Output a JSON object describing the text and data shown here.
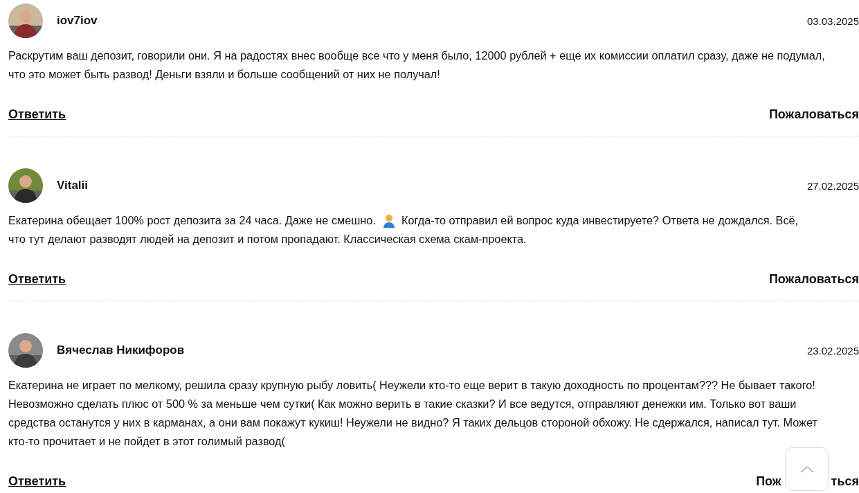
{
  "comments": [
    {
      "author": "iov7iov",
      "date": "03.03.2025",
      "text_before_icon": "Раскрутим ваш депозит, говорили они. Я на радостях внес вообще все что у меня было, 12000 рублей + еще их комиссии оплатил сразу, даже не подумал, что это может быть развод! Деньги взяли и больше сообщений от них не получал!",
      "reply": "Ответить",
      "report_parts": [
        "Пожаловаться"
      ]
    },
    {
      "author": "Vitalii",
      "date": "27.02.2025",
      "text_before_icon": "Екатерина обещает 100% рост депозита за 24 часа. Даже не смешно.",
      "text_after_icon": "Когда-то отправил ей вопрос куда инвестируете? Ответа не дождался. Всё,",
      "text_continued": "что тут делают разводят людей на депозит и потом пропадают. Классическая схема скам-проекта.",
      "reply": "Ответить",
      "report_parts": [
        "Пожаловаться"
      ]
    },
    {
      "author": "Вячеслав Никифоров",
      "date": "23.02.2025",
      "text_before_icon": "Екатерина не играет по мелкому, решила сразу крупную рыбу ловить( Неужели кто-то еще верит в такую доходность по процентам??? Не бывает такого! Невозможно сделать плюс от 500 % за меньше чем сутки( Как можно верить в такие сказки? И все ведутся, отправляют денежки им. Только вот ваши средства останутся у них в карманах, а они вам покажут кукиш! Неужели не видно? Я таких дельцов стороной обхожу. Не сдержался, написал тут. Может кто-то прочитает и не пойдет в этот голимый развод(",
      "reply": "Ответить",
      "report_parts": [
        "Пож",
        "ться"
      ]
    }
  ]
}
